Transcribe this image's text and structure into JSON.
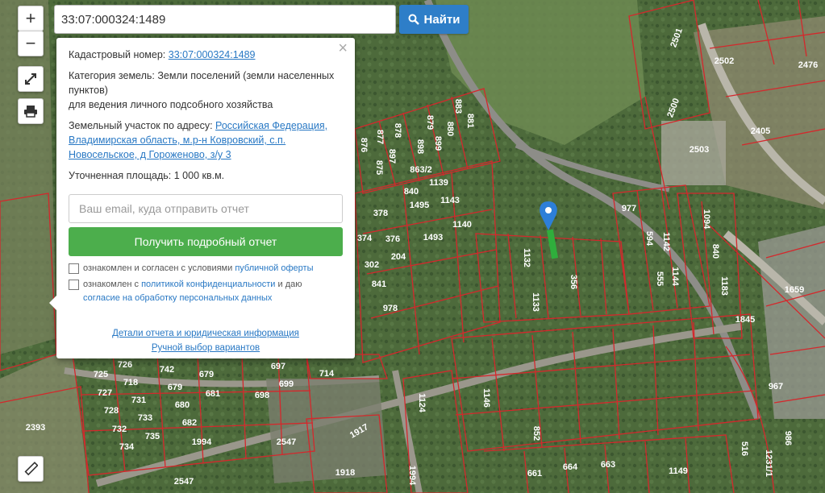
{
  "search": {
    "value": "33:07:000324:1489",
    "button_label": "Найти"
  },
  "controls": {
    "zoom_in": "+",
    "zoom_out": "−"
  },
  "popup": {
    "cadastral_label": "Кадастровый номер:",
    "cadastral_value": "33:07:000324:1489",
    "category_label": "Категория земель:",
    "category_value": "Земли поселений (земли населенных пунктов)",
    "category_value2": "для ведения личного подсобного хозяйства",
    "address_label": "Земельный участок по адресу:",
    "address_value": "Российская Федерация, Владимирская область, м.р-н Ковровский, с.п. Новосельское, д Гороженово, з/у 3",
    "area_label": "Уточненная площадь:",
    "area_value": "1 000 кв.м.",
    "email_placeholder": "Ваш email, куда отправить отчет",
    "report_button": "Получить подробный отчет",
    "consent1_prefix": "ознакомлен и согласен с условиями ",
    "consent1_link": "публичной оферты",
    "consent2_prefix": "ознакомлен с ",
    "consent2_link": "политикой конфиденциальности",
    "consent2_suffix": " и даю",
    "consent2_link2": "согласие на обработку персональных данных",
    "link_details": "Детали отчета и юридическая информация",
    "link_manual": "Ручной выбор вариантов"
  },
  "parcels": [
    "2501",
    "2502",
    "2476",
    "2500",
    "2405",
    "2503",
    "1094",
    "840",
    "1183",
    "1659",
    "1845",
    "967",
    "986",
    "1231/1",
    "516",
    "2393",
    "2547",
    "1994",
    "1917",
    "1918",
    "1149",
    "661",
    "664",
    "663",
    "725",
    "726",
    "727",
    "728",
    "732",
    "734",
    "718",
    "731",
    "733",
    "735",
    "742",
    "679",
    "680",
    "681",
    "682",
    "697",
    "698",
    "699",
    "714",
    "1124",
    "1146",
    "852",
    "1495",
    "1143",
    "1493",
    "1140",
    "1139",
    "840",
    "863/2",
    "378",
    "374",
    "376",
    "302",
    "204",
    "841",
    "978",
    "1132",
    "1133",
    "356",
    "594",
    "1142",
    "555",
    "1144",
    "977",
    "883",
    "881",
    "880",
    "879",
    "878",
    "877",
    "876",
    "875",
    "899",
    "898",
    "897"
  ]
}
